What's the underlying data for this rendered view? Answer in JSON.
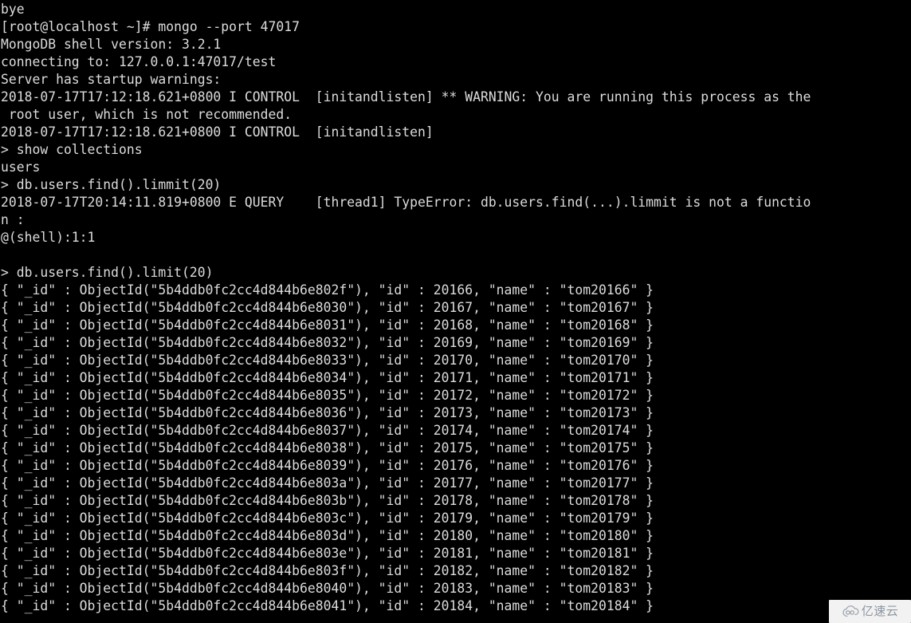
{
  "terminal": {
    "title": "MongoDB shell session",
    "colors": {
      "background": "#000000",
      "foreground": "#dcdcdc"
    },
    "prompt_host": "[root@localhost ~]#",
    "shell_prompt": ">",
    "lines": [
      "bye",
      "[root@localhost ~]# mongo --port 47017",
      "MongoDB shell version: 3.2.1",
      "connecting to: 127.0.0.1:47017/test",
      "Server has startup warnings:",
      "2018-07-17T17:12:18.621+0800 I CONTROL  [initandlisten] ** WARNING: You are running this process as the",
      " root user, which is not recommended.",
      "2018-07-17T17:12:18.621+0800 I CONTROL  [initandlisten]",
      "> show collections",
      "users",
      "> db.users.find().limmit(20)",
      "2018-07-17T20:14:11.819+0800 E QUERY    [thread1] TypeError: db.users.find(...).limmit is not a functio",
      "n :",
      "@(shell):1:1",
      "",
      "> db.users.find().limit(20)",
      "{ \"_id\" : ObjectId(\"5b4ddb0fc2cc4d844b6e802f\"), \"id\" : 20166, \"name\" : \"tom20166\" }",
      "{ \"_id\" : ObjectId(\"5b4ddb0fc2cc4d844b6e8030\"), \"id\" : 20167, \"name\" : \"tom20167\" }",
      "{ \"_id\" : ObjectId(\"5b4ddb0fc2cc4d844b6e8031\"), \"id\" : 20168, \"name\" : \"tom20168\" }",
      "{ \"_id\" : ObjectId(\"5b4ddb0fc2cc4d844b6e8032\"), \"id\" : 20169, \"name\" : \"tom20169\" }",
      "{ \"_id\" : ObjectId(\"5b4ddb0fc2cc4d844b6e8033\"), \"id\" : 20170, \"name\" : \"tom20170\" }",
      "{ \"_id\" : ObjectId(\"5b4ddb0fc2cc4d844b6e8034\"), \"id\" : 20171, \"name\" : \"tom20171\" }",
      "{ \"_id\" : ObjectId(\"5b4ddb0fc2cc4d844b6e8035\"), \"id\" : 20172, \"name\" : \"tom20172\" }",
      "{ \"_id\" : ObjectId(\"5b4ddb0fc2cc4d844b6e8036\"), \"id\" : 20173, \"name\" : \"tom20173\" }",
      "{ \"_id\" : ObjectId(\"5b4ddb0fc2cc4d844b6e8037\"), \"id\" : 20174, \"name\" : \"tom20174\" }",
      "{ \"_id\" : ObjectId(\"5b4ddb0fc2cc4d844b6e8038\"), \"id\" : 20175, \"name\" : \"tom20175\" }",
      "{ \"_id\" : ObjectId(\"5b4ddb0fc2cc4d844b6e8039\"), \"id\" : 20176, \"name\" : \"tom20176\" }",
      "{ \"_id\" : ObjectId(\"5b4ddb0fc2cc4d844b6e803a\"), \"id\" : 20177, \"name\" : \"tom20177\" }",
      "{ \"_id\" : ObjectId(\"5b4ddb0fc2cc4d844b6e803b\"), \"id\" : 20178, \"name\" : \"tom20178\" }",
      "{ \"_id\" : ObjectId(\"5b4ddb0fc2cc4d844b6e803c\"), \"id\" : 20179, \"name\" : \"tom20179\" }",
      "{ \"_id\" : ObjectId(\"5b4ddb0fc2cc4d844b6e803d\"), \"id\" : 20180, \"name\" : \"tom20180\" }",
      "{ \"_id\" : ObjectId(\"5b4ddb0fc2cc4d844b6e803e\"), \"id\" : 20181, \"name\" : \"tom20181\" }",
      "{ \"_id\" : ObjectId(\"5b4ddb0fc2cc4d844b6e803f\"), \"id\" : 20182, \"name\" : \"tom20182\" }",
      "{ \"_id\" : ObjectId(\"5b4ddb0fc2cc4d844b6e8040\"), \"id\" : 20183, \"name\" : \"tom20183\" }",
      "{ \"_id\" : ObjectId(\"5b4ddb0fc2cc4d844b6e8041\"), \"id\" : 20184, \"name\" : \"tom20184\" }"
    ]
  },
  "watermark": {
    "text": "亿速云",
    "icon": "cloud-icon",
    "color": "#8d96a0",
    "background": "#f2f2f2"
  }
}
